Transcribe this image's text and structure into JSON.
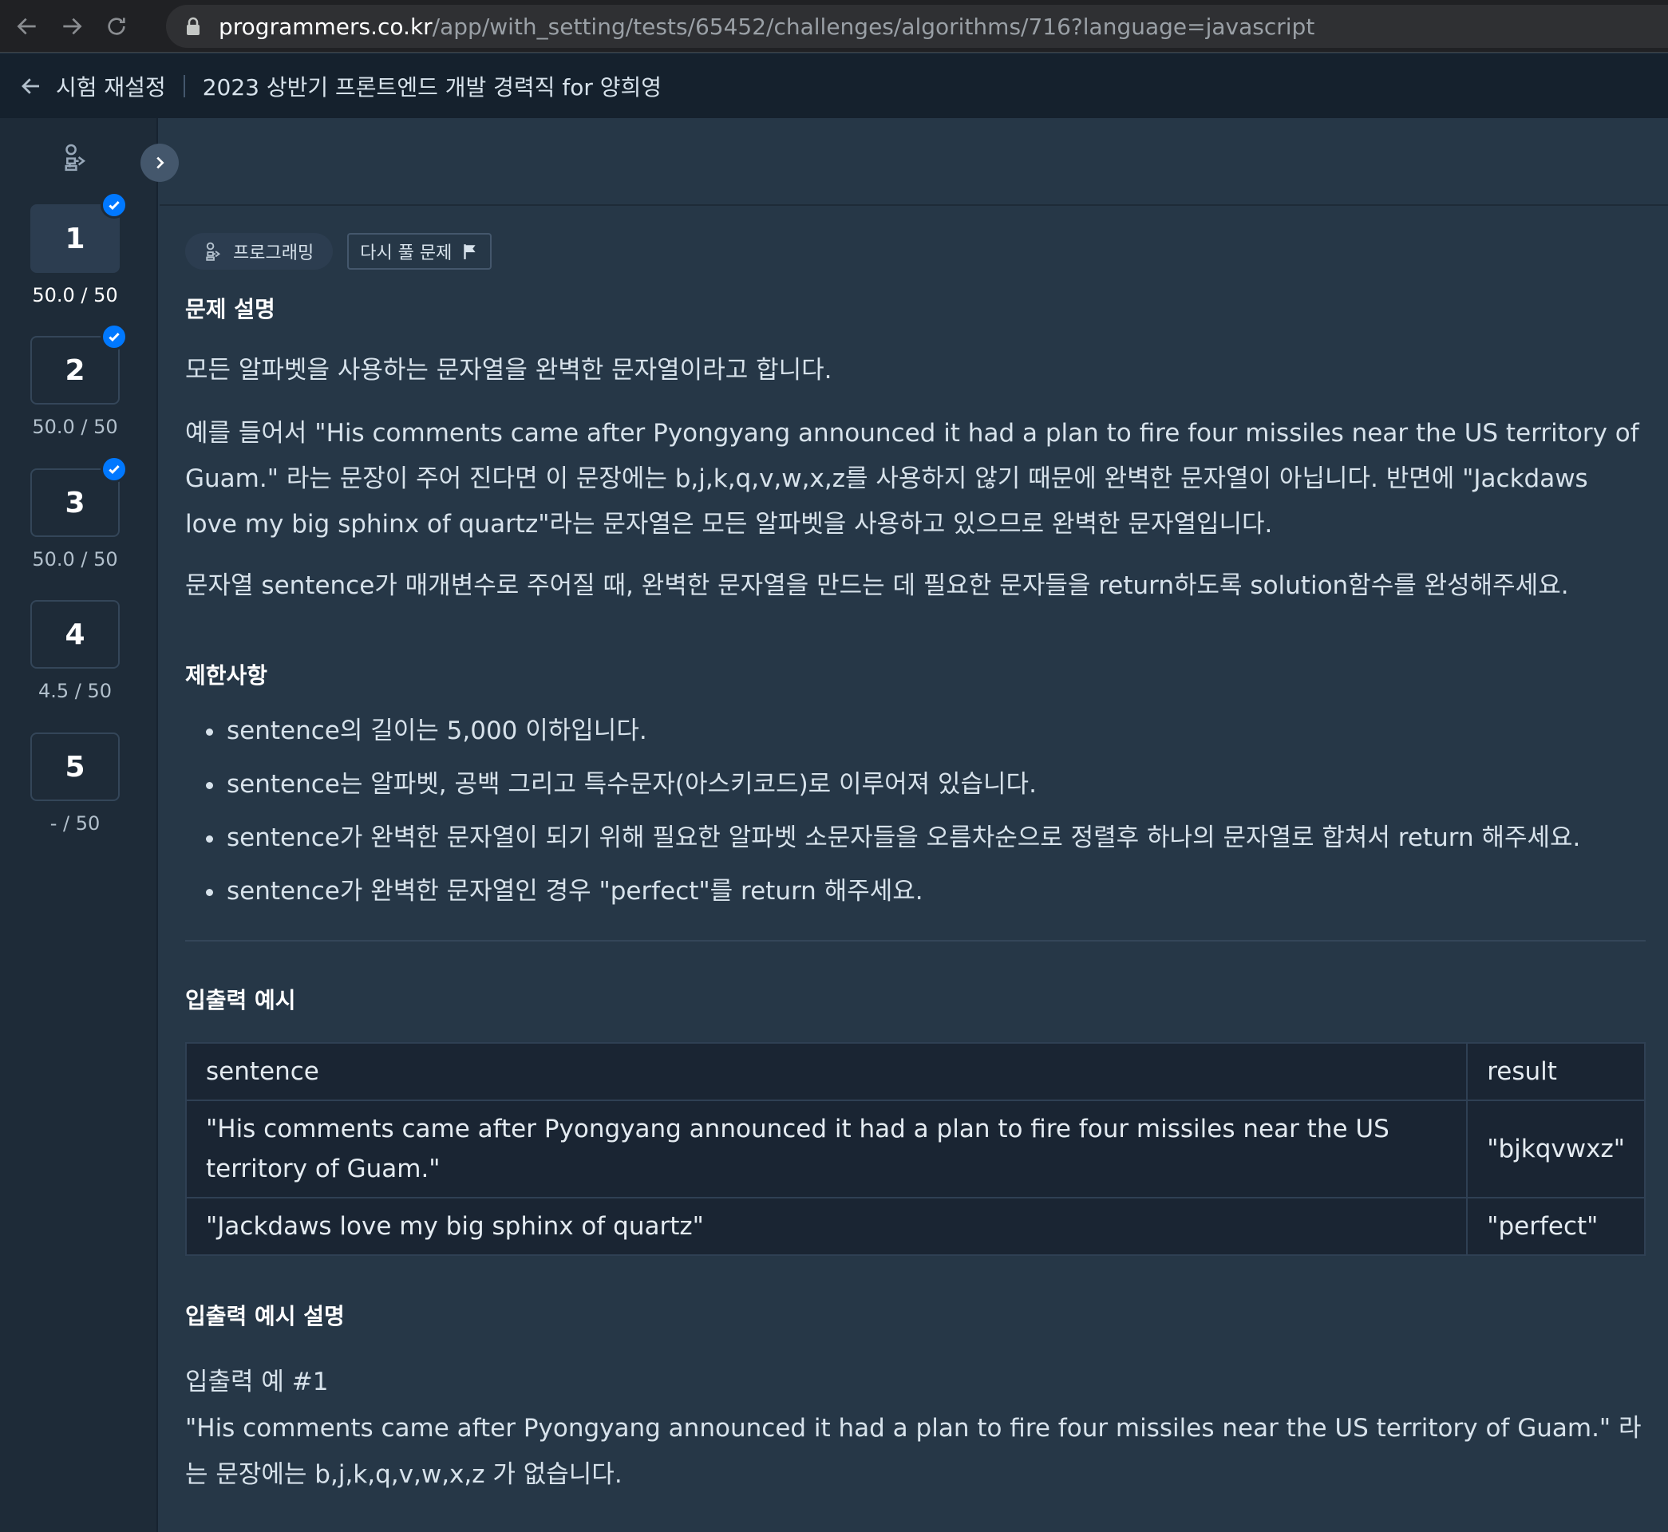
{
  "browser": {
    "url_host": "programmers.co.kr",
    "url_path": "/app/with_setting/tests/65452/challenges/algorithms/716?language=javascript"
  },
  "header": {
    "back_label": "시험 재설정",
    "test_title": "2023 상반기 프론트엔드 개발 경력직 for 양희영"
  },
  "sidebar": {
    "problems": [
      {
        "number": "1",
        "score": "50.0 / 50",
        "solved": true,
        "active": true
      },
      {
        "number": "2",
        "score": "50.0 / 50",
        "solved": true,
        "active": false
      },
      {
        "number": "3",
        "score": "50.0 / 50",
        "solved": true,
        "active": false
      },
      {
        "number": "4",
        "score": "4.5 / 50",
        "solved": false,
        "active": false
      },
      {
        "number": "5",
        "score": "- / 50",
        "solved": false,
        "active": false
      }
    ]
  },
  "tags": {
    "category": "프로그래밍",
    "retry": "다시 풀 문제"
  },
  "problem": {
    "title": "문제 설명",
    "paragraphs": [
      "모든 알파벳을 사용하는 문자열을 완벽한 문자열이라고 합니다.",
      "예를 들어서 \"His comments came after Pyongyang announced it had a plan to fire four missiles near the US territory of Guam.\" 라는 문장이 주어 진다면 이 문장에는 b,j,k,q,v,w,x,z를 사용하지 않기 때문에 완벽한 문자열이 아닙니다. 반면에 \"Jackdaws love my big sphinx of quartz\"라는 문자열은 모든 알파벳을 사용하고 있으므로 완벽한 문자열입니다.",
      "문자열 sentence가 매개변수로 주어질 때, 완벽한 문자열을 만드는 데 필요한 문자들을 return하도록 solution함수를 완성해주세요."
    ],
    "constraints_title": "제한사항",
    "constraints": [
      "sentence의 길이는 5,000 이하입니다.",
      "sentence는 알파벳, 공백 그리고 특수문자(아스키코드)로 이루어져 있습니다.",
      "sentence가 완벽한 문자열이 되기 위해 필요한 알파벳 소문자들을 오름차순으로 정렬후 하나의 문자열로 합쳐서 return 해주세요.",
      "sentence가 완벽한 문자열인 경우 \"perfect\"를 return 해주세요."
    ],
    "examples_title": "입출력 예시",
    "table": {
      "headers": [
        "sentence",
        "result"
      ],
      "rows": [
        [
          "\"His comments came after Pyongyang announced it had a plan to fire four missiles near the US territory of Guam.\"",
          "\"bjkqvwxz\""
        ],
        [
          "\"Jackdaws love my big sphinx of quartz\"",
          "\"perfect\""
        ]
      ]
    },
    "explanation_title": "입출력 예시 설명",
    "example_label": "입출력 예 #1",
    "example_desc": "\"His comments came after Pyongyang announced it had a plan to fire four missiles near the US territory of Guam.\" 라는 문장에는 b,j,k,q,v,w,x,z 가 없습니다."
  },
  "colors": {
    "check_badge": "#0078ff",
    "background": "#263747",
    "sidebar": "#1e2b38"
  },
  "icons": {
    "back": "arrow-left-icon",
    "forward": "arrow-right-icon",
    "reload": "reload-icon",
    "lock": "lock-icon",
    "category": "code-blocks-icon",
    "flag": "flag-icon",
    "check": "check-icon",
    "collapse": "chevron-right-icon"
  }
}
